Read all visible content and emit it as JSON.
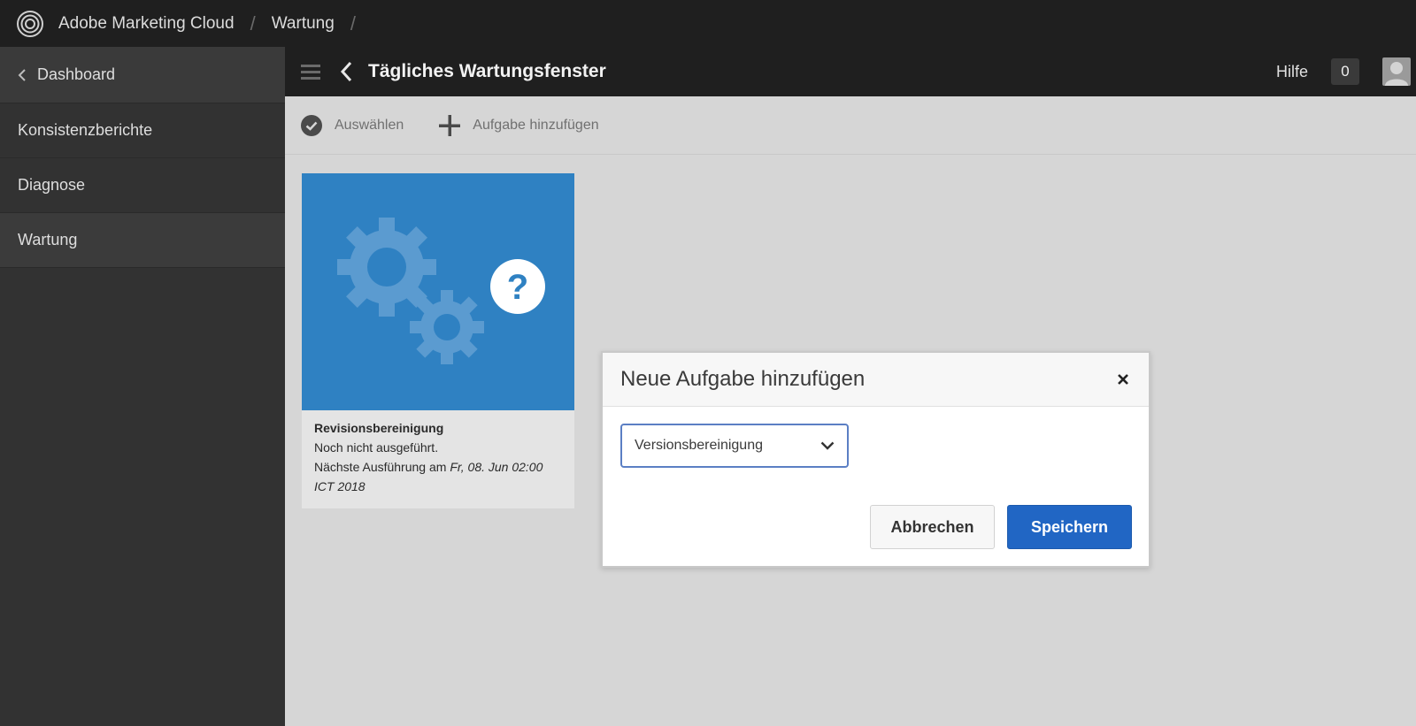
{
  "globalbar": {
    "app_name": "Adobe Marketing Cloud",
    "breadcrumb": [
      "Wartung"
    ],
    "separator": "/"
  },
  "sidebar": {
    "back_label": "Dashboard",
    "items": [
      {
        "label": "Konsistenzberichte",
        "active": false
      },
      {
        "label": "Diagnose",
        "active": false
      },
      {
        "label": "Wartung",
        "active": true
      }
    ]
  },
  "header": {
    "title": "Tägliches Wartungsfenster",
    "help_label": "Hilfe",
    "notification_count": "0"
  },
  "actionbar": {
    "select_label": "Auswählen",
    "add_task_label": "Aufgabe hinzufügen"
  },
  "card": {
    "title": "Revisionsbereinigung",
    "status": "Noch nicht ausgeführt.",
    "next_prefix": "Nächste Ausführung am ",
    "next_date": "Fr, 08. Jun 02:00 ICT 2018",
    "thumb_color": "#2f81c2"
  },
  "dialog": {
    "title": "Neue Aufgabe hinzufügen",
    "select_value": "Versionsbereinigung",
    "cancel_label": "Abbrechen",
    "save_label": "Speichern"
  },
  "colors": {
    "accent": "#2166c4",
    "sidebar_bg": "#323232",
    "topbar_bg": "#1f1f1f"
  }
}
